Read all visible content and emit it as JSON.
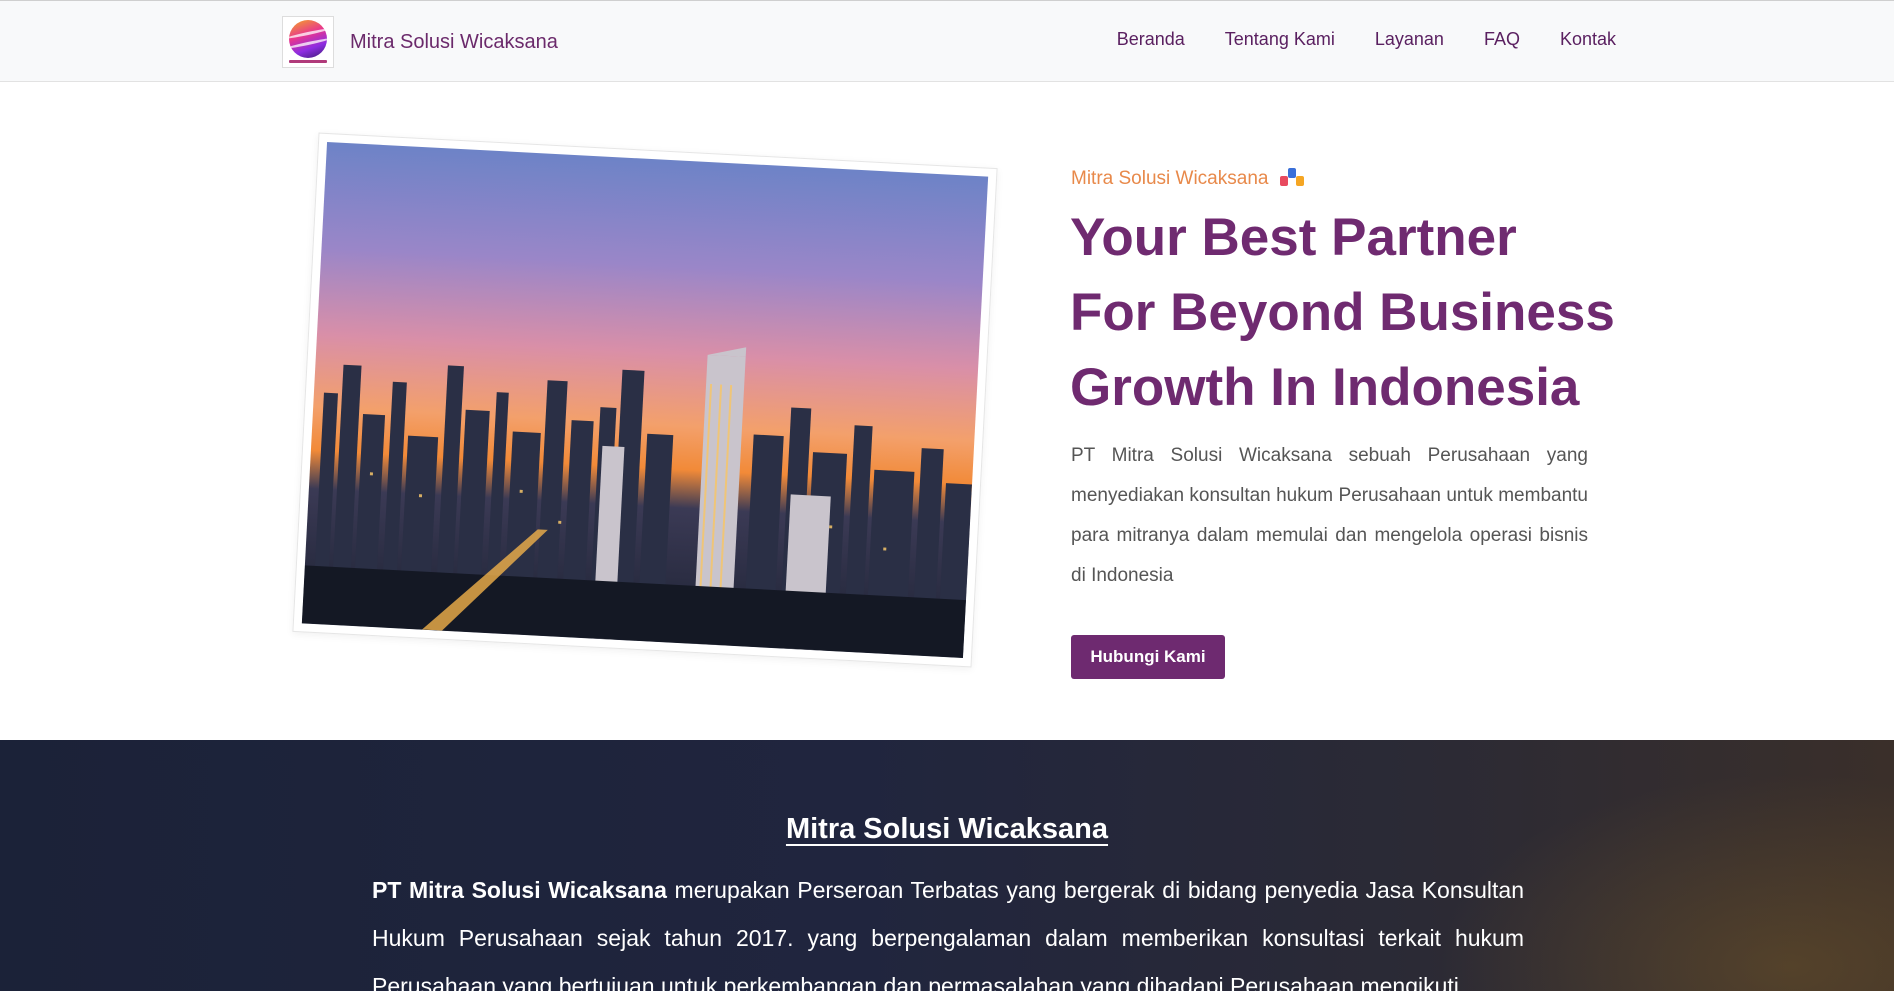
{
  "navbar": {
    "brand_name": "Mitra Solusi Wicaksana",
    "links": [
      "Beranda",
      "Tentang Kami",
      "Layanan",
      "FAQ",
      "Kontak"
    ]
  },
  "hero": {
    "kicker": "Mitra Solusi Wicaksana",
    "title_lines": [
      "Your Best Partner",
      "For Beyond Business",
      "Growth In Indonesia"
    ],
    "description": "PT Mitra Solusi Wicaksana sebuah Perusahaan yang menyediakan konsultan hukum Perusahaan untuk membantu para mitranya dalam memulai dan mengelola operasi bisnis di Indonesia",
    "button_label": "Hubungi Kami"
  },
  "about": {
    "title": "Mitra Solusi Wicaksana",
    "company_bold": "PT Mitra Solusi Wicaksana",
    "text": " merupakan Perseroan Terbatas yang bergerak di bidang penyedia Jasa Konsultan Hukum Perusahaan sejak tahun 2017. yang berpengalaman dalam memberikan konsultasi terkait hukum Perusahaan yang bertujuan untuk perkembangan dan permasalahan yang dihadapi Perusahaan mengikuti"
  },
  "colors": {
    "brand_purple": "#6e2a70",
    "accent_orange": "#e8894a",
    "section_dark": "#1b2238"
  }
}
